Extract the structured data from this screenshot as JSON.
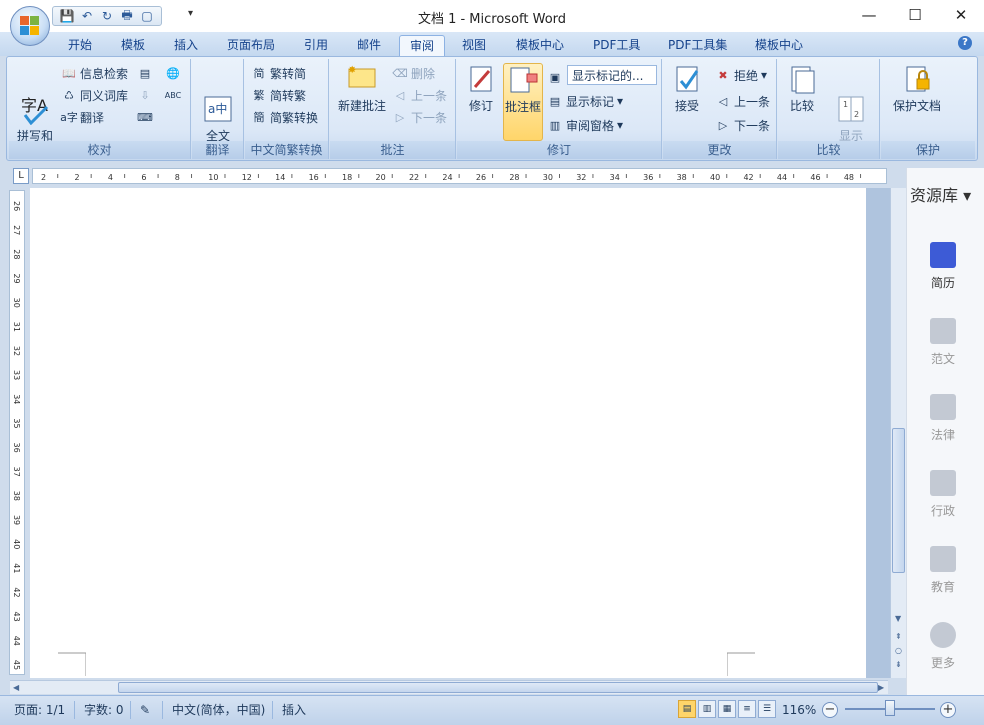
{
  "window": {
    "title": "文档 1 - Microsoft Word",
    "minimize": "—",
    "maximize": "☐",
    "close": "✕"
  },
  "qat": {
    "save": "💾",
    "undo": "↶",
    "redo": "↻",
    "print": "🖶",
    "preview": "▢",
    "more": "▾"
  },
  "tabs": [
    "开始",
    "模板",
    "插入",
    "页面布局",
    "引用",
    "邮件",
    "审阅",
    "视图",
    "模板中心",
    "PDF工具",
    "PDF工具集",
    "模板中心"
  ],
  "active_tab": "审阅",
  "ribbon": {
    "proofing": {
      "label": "校对",
      "spelling": "拼写和\n语法",
      "research": "信息检索",
      "thesaurus": "同义词库",
      "translate": "翻译"
    },
    "translate_group": {
      "label": "翻译",
      "full_translate": "全文\n翻译"
    },
    "chinese": {
      "label": "中文简繁转换",
      "t2s": "繁转简",
      "s2t": "简转繁",
      "convert": "简繁转换"
    },
    "comments": {
      "label": "批注",
      "new": "新建批注",
      "delete": "删除",
      "prev": "上一条",
      "next": "下一条"
    },
    "tracking": {
      "label": "修订",
      "track": "修订",
      "balloons": "批注框",
      "display_markup": "显示标记的...",
      "show_markup": "显示标记",
      "reviewing_pane": "审阅窗格"
    },
    "changes": {
      "label": "更改",
      "accept": "接受",
      "reject": "拒绝",
      "prev": "上一条",
      "next": "下一条"
    },
    "compare": {
      "label": "比较",
      "compare": "比较",
      "show_source": "显示\n源文档"
    },
    "protect": {
      "label": "保护",
      "protect_doc": "保护文档"
    }
  },
  "ruler": {
    "corner": "L",
    "h_ticks": [
      "2",
      "2",
      "4",
      "6",
      "8",
      "10",
      "12",
      "14",
      "16",
      "18",
      "20",
      "22",
      "24",
      "26",
      "28",
      "30",
      "32",
      "34",
      "36",
      "38",
      "40",
      "42",
      "44",
      "46",
      "48"
    ],
    "v_ticks": [
      "26",
      "27",
      "28",
      "29",
      "30",
      "31",
      "32",
      "33",
      "34",
      "35",
      "36",
      "37",
      "38",
      "39",
      "40",
      "41",
      "42",
      "43",
      "44",
      "45"
    ]
  },
  "side_panel": {
    "title": "资源库 ▾",
    "items": [
      {
        "label": "简历",
        "active": true
      },
      {
        "label": "范文",
        "active": false
      },
      {
        "label": "法律",
        "active": false
      },
      {
        "label": "行政",
        "active": false
      },
      {
        "label": "教育",
        "active": false
      },
      {
        "label": "更多",
        "active": false
      }
    ]
  },
  "status": {
    "page": "页面: 1/1",
    "words": "字数: 0",
    "language": "中文(简体，中国)",
    "mode": "插入",
    "zoom": "116%",
    "zoom_out": "−",
    "zoom_in": "+"
  },
  "colors": {
    "accent": "#3d5bd6",
    "ribbon_bg": "#dce8f7",
    "highlight": "#ffd56a"
  }
}
